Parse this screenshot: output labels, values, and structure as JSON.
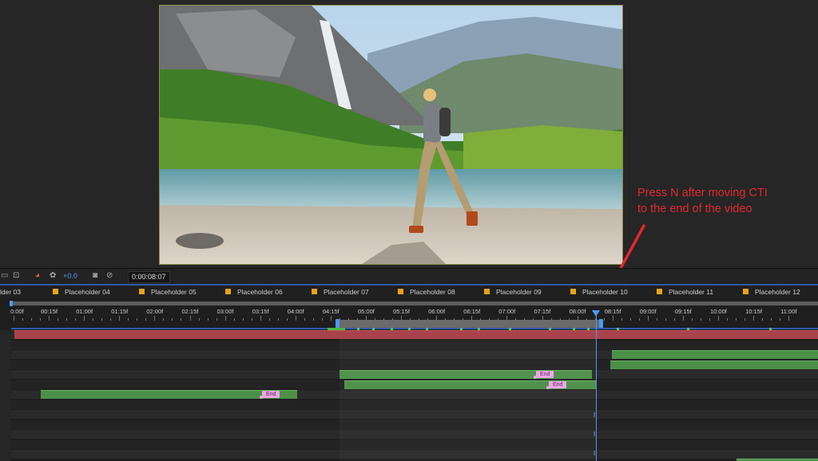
{
  "annotation": {
    "line1": "Press N after moving CTI",
    "line2": "to the end of the video",
    "color": "#e2282f"
  },
  "toolbar": {
    "icons": [
      "monitor-icon",
      "region-icon",
      "color-wheel-icon",
      "settings-icon",
      "camera-icon",
      "snapshot-icon"
    ],
    "fx_value": "+0.0",
    "timecode": "0:00:08:07"
  },
  "markers": [
    "lder 03",
    "Placeholder 04",
    "Placeholder 05",
    "Placeholder 06",
    "Placeholder 07",
    "Placeholder 08",
    "Placeholder 09",
    "Placeholder 10",
    "Placeholder 11",
    "Placeholder 12"
  ],
  "marker_color": "#e8a21a",
  "ruler": {
    "labels": [
      "0:00f",
      "00:15f",
      "01:00f",
      "01:15f",
      "02:00f",
      "02:15f",
      "03:00f",
      "03:15f",
      "04:00f",
      "04:15f",
      "05:00f",
      "05:15f",
      "06:00f",
      "06:15f",
      "07:00f",
      "07:15f",
      "08:00f",
      "08:15f",
      "09:00f",
      "09:15f",
      "10:00f",
      "10:15f",
      "11:00f"
    ]
  },
  "clips": {
    "end_label": "End"
  },
  "accent_color": "#4a9af0"
}
